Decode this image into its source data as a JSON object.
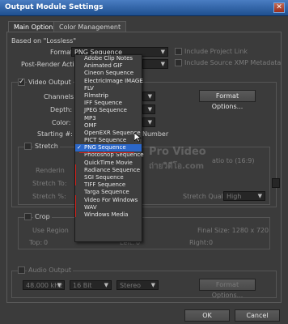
{
  "window": {
    "title": "Output Module Settings",
    "close_glyph": "✕"
  },
  "tabs": [
    {
      "label": "Main Options"
    },
    {
      "label": "Color Management"
    }
  ],
  "based_on": "Based on \"Lossless\"",
  "format": {
    "label": "Format:",
    "value": "PNG Sequence"
  },
  "post_render": {
    "label": "Post-Render Action:"
  },
  "include_project_link": "Include Project Link",
  "include_xmp": "Include Source XMP Metadata",
  "video_output": {
    "label": "Video Output",
    "channels_label": "Channels:",
    "depth_label": "Depth:",
    "color_label": "Color:",
    "starting_label": "Starting #:",
    "number_suffix": "Number",
    "format_options": "Format Options..."
  },
  "stretch": {
    "label": "Stretch",
    "rendering_label": "Renderin",
    "stretch_to_label": "Stretch To:",
    "stretch_pct_label": "Stretch %:",
    "ratio_partial": "atio to (16:9)",
    "quality_label": "Stretch Quality:",
    "quality_value": "High"
  },
  "crop": {
    "label": "Crop",
    "use_region_partial": "Use Region",
    "final_size": "Final Size: 1280 x 720",
    "top_label": "Top:",
    "top_value": "0",
    "left_label": "Left:",
    "left_value": "0",
    "right_label": "Right:",
    "right_value": "0"
  },
  "audio": {
    "label": "Audio Output",
    "rate": "48.000 kHz",
    "bits": "16 Bit",
    "channels": "Stereo",
    "format_options": "Format Options..."
  },
  "buttons": {
    "ok": "OK",
    "cancel": "Cancel"
  },
  "watermark": {
    "line1": "Pro Video",
    "line2": "ถ่ายวิดีโอ.com"
  },
  "dropdown": {
    "items": [
      "Adobe Clip Notes",
      "Animated GIF",
      "Cineon Sequence",
      "ElectricImage IMAGE",
      "FLV",
      "Filmstrip",
      "IFF Sequence",
      "JPEG Sequence",
      "MP3",
      "OMF",
      "OpenEXR Sequence",
      "PICT Sequence",
      "PNG Sequence",
      "Photoshop Sequence",
      "QuickTime Movie",
      "Radiance Sequence",
      "SGI Sequence",
      "TIFF Sequence",
      "Targa Sequence",
      "Video For Windows",
      "WAV",
      "Windows Media"
    ],
    "selected_index": 12,
    "check_glyph": "✓"
  },
  "colors": {
    "selection": "#2c67c8",
    "annotation_red": "#d8221c",
    "title_bar": "#2a5ea8"
  }
}
